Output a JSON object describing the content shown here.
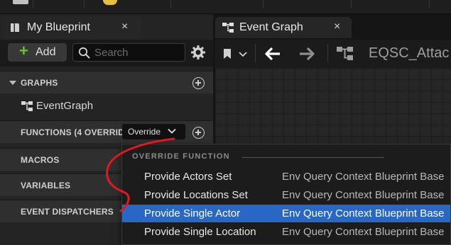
{
  "left_tab": {
    "title": "My Blueprint",
    "close": "×"
  },
  "toolbar": {
    "add_label": "Add",
    "search_placeholder": "Search"
  },
  "sections": {
    "graphs": "GRAPHS",
    "functions": "FUNCTIONS (4 OVERRID",
    "macros": "MACROS",
    "variables": "VARIABLES",
    "event_dispatchers": "EVENT DISPATCHERS"
  },
  "graph_item": "EventGraph",
  "override_button": "Override",
  "graph_tab": {
    "title": "Event Graph",
    "close": "×"
  },
  "graph_toolbar": {
    "title": "EQSC_Attac"
  },
  "popup": {
    "header": "OVERRIDE FUNCTION",
    "items": [
      {
        "name": "Provide Actors Set",
        "category": "Env Query Context Blueprint Base"
      },
      {
        "name": "Provide Locations Set",
        "category": "Env Query Context Blueprint Base"
      },
      {
        "name": "Provide Single Actor",
        "category": "Env Query Context Blueprint Base",
        "selected": true
      },
      {
        "name": "Provide Single Location",
        "category": "Env Query Context Blueprint Base"
      }
    ]
  },
  "colors": {
    "selection": "#2868c4",
    "add_plus": "#69c242",
    "annotation": "#e0191e"
  }
}
